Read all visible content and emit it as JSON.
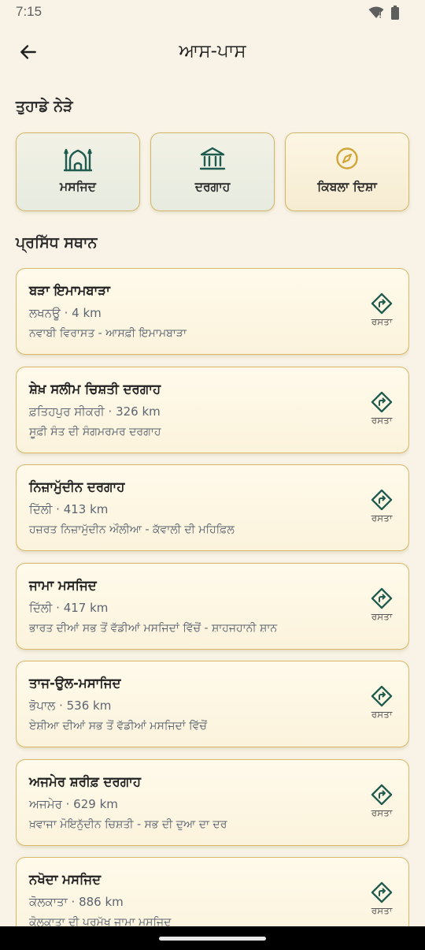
{
  "status_bar": {
    "time": "7:15"
  },
  "app_bar": {
    "title": "ਆਸ-ਪਾਸ"
  },
  "nearby": {
    "heading": "ਤੁਹਾਡੇ ਨੇੜੇ",
    "categories": [
      {
        "label": "ਮਸਜਿਦ",
        "icon": "mosque-icon"
      },
      {
        "label": "ਦਰਗਾਹ",
        "icon": "dargah-building-icon"
      },
      {
        "label": "ਕਿਬਲਾ ਦਿਸ਼ਾ",
        "icon": "compass-icon"
      }
    ]
  },
  "famous": {
    "heading": "ਪ੍ਰਸਿੱਧ ਸਥਾਨ",
    "route_label": "ਰਸਤਾ",
    "places": [
      {
        "name": "ਬੜਾ ਇਮਾਮਬਾੜਾ",
        "meta": "ਲਖਨਊ · 4 km",
        "desc": "ਨਵਾਬੀ ਵਿਰਾਸਤ - ਆਸਫ਼ੀ ਇਮਾਮਬਾੜਾ"
      },
      {
        "name": "ਸ਼ੇਖ਼ ਸਲੀਮ ਚਿਸ਼ਤੀ ਦਰਗਾਹ",
        "meta": "ਫ਼ਤਿਹਪੁਰ ਸੀਕਰੀ · 326 km",
        "desc": "ਸੂਫ਼ੀ ਸੰਤ ਦੀ ਸੰਗਮਰਮਰ ਦਰਗਾਹ"
      },
      {
        "name": "ਨਿਜ਼ਾਮੁੱਦੀਨ ਦਰਗਾਹ",
        "meta": "ਦਿੱਲੀ · 413 km",
        "desc": "ਹਜ਼ਰਤ ਨਿਜ਼ਾਮੁੱਦੀਨ ਔਲੀਆ - ਕੱਵਾਲੀ ਦੀ ਮਹਿਫ਼ਿਲ"
      },
      {
        "name": "ਜਾਮਾ ਮਸਜਿਦ",
        "meta": "ਦਿੱਲੀ · 417 km",
        "desc": "ਭਾਰਤ ਦੀਆਂ ਸਭ ਤੋਂ ਵੱਡੀਆਂ ਮਸਜਿਦਾਂ ਵਿੱਚੋਂ - ਸ਼ਾਹਜਹਾਨੀ ਸ਼ਾਨ"
      },
      {
        "name": "ਤਾਜ-ਉਲ-ਮਸਾਜਿਦ",
        "meta": "ਭੋਪਾਲ · 536 km",
        "desc": "ਏਸ਼ੀਆ ਦੀਆਂ ਸਭ ਤੋਂ ਵੱਡੀਆਂ ਮਸਜਿਦਾਂ ਵਿੱਚੋਂ"
      },
      {
        "name": "ਅਜਮੇਰ ਸ਼ਰੀਫ਼ ਦਰਗਾਹ",
        "meta": "ਅਜਮੇਰ · 629 km",
        "desc": "ਖ਼ਵਾਜਾ ਮੋਇਨੁੱਦੀਨ ਚਿਸ਼ਤੀ - ਸਭ ਦੀ ਦੁਆ ਦਾ ਦਰ"
      },
      {
        "name": "ਨਖੋਦਾ ਮਸਜਿਦ",
        "meta": "ਕੋਲਕਾਤਾ · 886 km",
        "desc": "ਕੋਲਕਾਤਾ ਦੀ ਪ੍ਰਮੁੱਖ ਜਾਮਾ ਮਸਜਿਦ"
      }
    ]
  },
  "colors": {
    "accent": "#1f5b4f",
    "gold": "#d2a53a",
    "background": "#f8f3e6"
  }
}
